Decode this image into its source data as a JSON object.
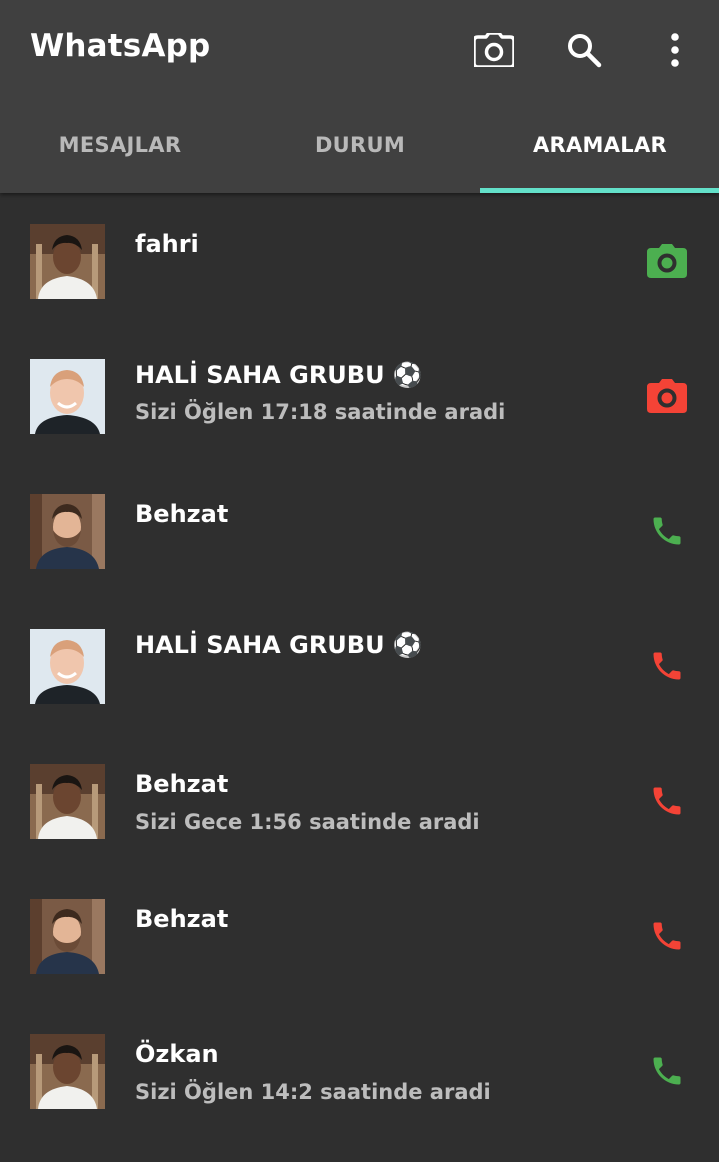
{
  "app": {
    "title": "WhatsApp"
  },
  "toolbar": {
    "camera_icon": "camera-icon",
    "search_icon": "search-icon",
    "menu_icon": "more-vertical-icon"
  },
  "tabs": [
    {
      "label": "MESAJLAR",
      "active": false
    },
    {
      "label": "DURUM",
      "active": false
    },
    {
      "label": "ARAMALAR",
      "active": true
    }
  ],
  "colors": {
    "accent": "#63e0c9",
    "call_green": "#4caf50",
    "call_red": "#f44336",
    "background": "#2f2f2f",
    "appbar": "#404040"
  },
  "calls": [
    {
      "name": "fahri",
      "subtitle": "",
      "type": "video",
      "status": "green",
      "avatar": "avatar-young-man"
    },
    {
      "name": "HALİ SAHA GRUBU ⚽",
      "subtitle": "Sizi Öğlen 17:18 saatinde aradi",
      "type": "video",
      "status": "red",
      "avatar": "avatar-bald-man"
    },
    {
      "name": "Behzat",
      "subtitle": "",
      "type": "voice",
      "status": "green",
      "avatar": "avatar-bearded-man"
    },
    {
      "name": "HALİ SAHA GRUBU ⚽",
      "subtitle": "",
      "type": "voice",
      "status": "red",
      "avatar": "avatar-bald-man"
    },
    {
      "name": "Behzat",
      "subtitle": "Sizi Gece 1:56 saatinde aradi",
      "type": "voice",
      "status": "red",
      "avatar": "avatar-young-man"
    },
    {
      "name": "Behzat",
      "subtitle": "",
      "type": "voice",
      "status": "red",
      "avatar": "avatar-bearded-man"
    },
    {
      "name": "Özkan",
      "subtitle": "Sizi Öğlen 14:2 saatinde aradi",
      "type": "voice",
      "status": "green",
      "avatar": "avatar-young-man"
    }
  ]
}
